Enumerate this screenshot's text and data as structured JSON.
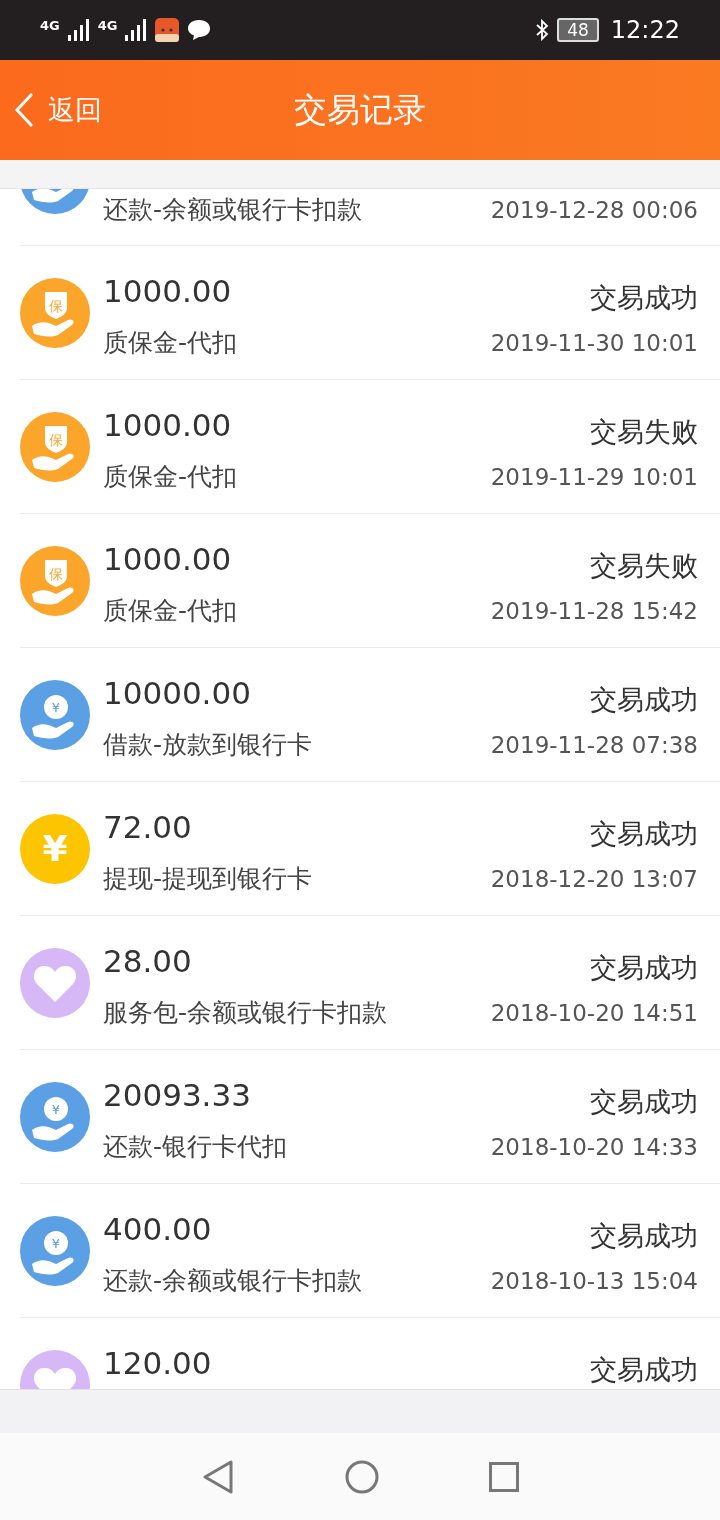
{
  "status_bar": {
    "network_1": "4G",
    "network_2": "4G",
    "battery": "48",
    "time": "12:22"
  },
  "header": {
    "back": "返回",
    "title": "交易记录"
  },
  "records": [
    {
      "kind": "loan",
      "description": "还款-余额或银行卡扣款",
      "date": "2019-12-28 00:06"
    },
    {
      "kind": "guarantee",
      "icon_glyph": "保",
      "amount": "1000.00",
      "status": "交易成功",
      "description": "质保金-代扣",
      "date": "2019-11-30 10:01"
    },
    {
      "kind": "guarantee",
      "icon_glyph": "保",
      "amount": "1000.00",
      "status": "交易失败",
      "description": "质保金-代扣",
      "date": "2019-11-29 10:01"
    },
    {
      "kind": "guarantee",
      "icon_glyph": "保",
      "amount": "1000.00",
      "status": "交易失败",
      "description": "质保金-代扣",
      "date": "2019-11-28 15:42"
    },
    {
      "kind": "loan",
      "icon_glyph": "¥",
      "amount": "10000.00",
      "status": "交易成功",
      "description": "借款-放款到银行卡",
      "date": "2019-11-28 07:38"
    },
    {
      "kind": "withdraw",
      "icon_glyph": "¥",
      "amount": "72.00",
      "status": "交易成功",
      "description": "提现-提现到银行卡",
      "date": "2018-12-20 13:07"
    },
    {
      "kind": "service",
      "amount": "28.00",
      "status": "交易成功",
      "description": "服务包-余额或银行卡扣款",
      "date": "2018-10-20 14:51"
    },
    {
      "kind": "loan",
      "icon_glyph": "¥",
      "amount": "20093.33",
      "status": "交易成功",
      "description": "还款-银行卡代扣",
      "date": "2018-10-20 14:33"
    },
    {
      "kind": "loan",
      "icon_glyph": "¥",
      "amount": "400.00",
      "status": "交易成功",
      "description": "还款-余额或银行卡扣款",
      "date": "2018-10-13 15:04"
    },
    {
      "kind": "service",
      "amount": "120.00",
      "status": "交易成功"
    }
  ]
}
